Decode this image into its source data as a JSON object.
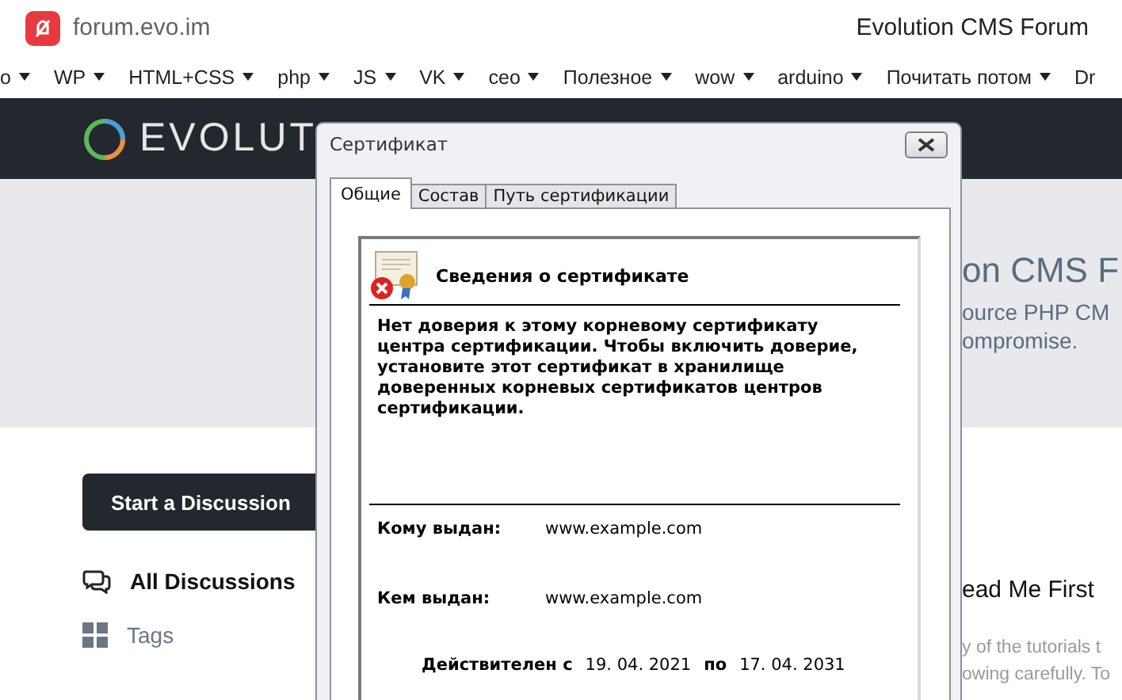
{
  "browser": {
    "address": "forum.evo.im",
    "page_title": "Evolution CMS Forum"
  },
  "bookmarks": [
    {
      "label": "o",
      "dropdown": true
    },
    {
      "label": "WP",
      "dropdown": true
    },
    {
      "label": "HTML+CSS",
      "dropdown": true
    },
    {
      "label": "php",
      "dropdown": true
    },
    {
      "label": "JS",
      "dropdown": true
    },
    {
      "label": "VK",
      "dropdown": true
    },
    {
      "label": "ceo",
      "dropdown": true
    },
    {
      "label": "Полезное",
      "dropdown": true
    },
    {
      "label": "wow",
      "dropdown": true
    },
    {
      "label": "arduino",
      "dropdown": true
    },
    {
      "label": "Почитать потом",
      "dropdown": true
    },
    {
      "label": "Dr",
      "dropdown": false
    }
  ],
  "header": {
    "logo_text": "EVOLUT"
  },
  "hero": {
    "title": "on CMS F",
    "description": [
      "ource PHP CM",
      "ompromise."
    ]
  },
  "sidebar": {
    "button": "Start a Discussion",
    "items": [
      {
        "label": "All Discussions",
        "selected": true,
        "kind": "chat"
      },
      {
        "label": "Tags",
        "selected": false,
        "kind": "grid"
      }
    ]
  },
  "post": {
    "title": "ead Me First",
    "lines": [
      "y of the tutorials t",
      "owing carefully. To"
    ]
  },
  "dialog": {
    "title": "Сертификат",
    "tabs": [
      {
        "label": "Общие",
        "selected": true
      },
      {
        "label": "Состав",
        "selected": false
      },
      {
        "label": "Путь сертификации",
        "selected": false
      }
    ],
    "heading": "Сведения о сертификате",
    "message": "Нет доверия к этому корневому сертификату центра сертификации. Чтобы включить  доверие, установите этот сертификат в хранилище доверенных корневых сертификатов центров сертификации.",
    "issued_to_label": "Кому выдан:",
    "issued_to": "www.example.com",
    "issued_by_label": "Кем выдан:",
    "issued_by": "www.example.com",
    "valid_from_label": "Действителен с",
    "valid_from": "19. 04. 2021",
    "valid_to_label": "по",
    "valid_to": "17. 04. 2031"
  }
}
